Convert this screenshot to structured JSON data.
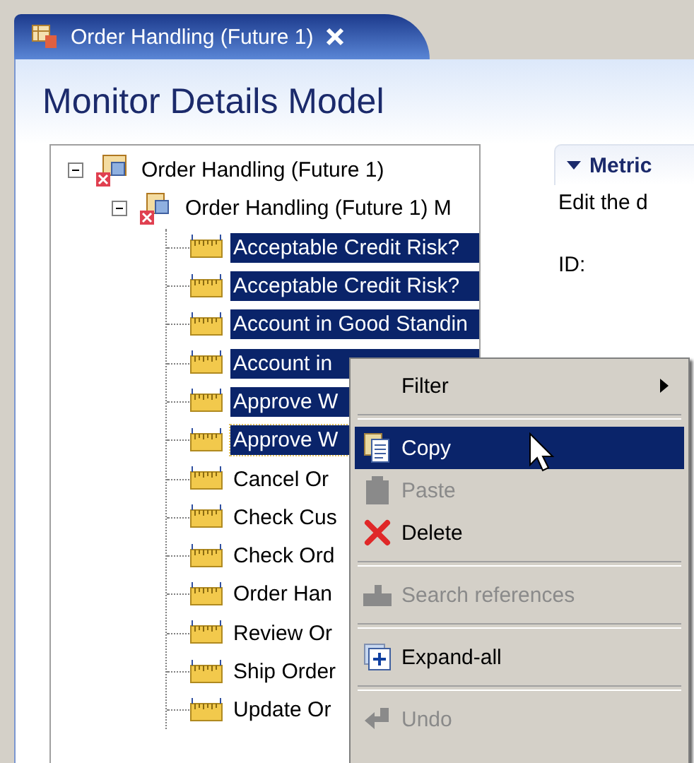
{
  "tab": {
    "title": "Order Handling (Future 1)",
    "selected": true
  },
  "page_title": "Monitor Details Model",
  "tree": [
    {
      "label": "Order Handling (Future 1)",
      "expanded": true,
      "children": [
        {
          "label": "Order Handling (Future 1) M",
          "expanded": true,
          "children": [
            {
              "label": "Acceptable Credit Risk?",
              "selected": true,
              "focused": false
            },
            {
              "label": "Acceptable Credit Risk?",
              "selected": true,
              "focused": false
            },
            {
              "label": "Account in Good Standin",
              "selected": true,
              "focused": false
            },
            {
              "label": "Account in",
              "selected": true,
              "focused": false
            },
            {
              "label": "Approve W",
              "selected": true,
              "focused": false
            },
            {
              "label": "Approve W",
              "selected": true,
              "focused": true
            },
            {
              "label": "Cancel Or",
              "selected": false,
              "focused": false
            },
            {
              "label": "Check Cus",
              "selected": false,
              "focused": false
            },
            {
              "label": "Check Ord",
              "selected": false,
              "focused": false
            },
            {
              "label": "Order Han",
              "selected": false,
              "focused": false
            },
            {
              "label": "Review Or",
              "selected": false,
              "focused": false
            },
            {
              "label": "Ship Order",
              "selected": false,
              "focused": false
            },
            {
              "label": "Update Or",
              "selected": false,
              "focused": false
            }
          ]
        }
      ]
    }
  ],
  "section": {
    "title": "Metric",
    "expanded": true,
    "description": "Edit the d",
    "fields": [
      {
        "label": "ID:"
      }
    ]
  },
  "context_menu": {
    "groups": [
      [
        {
          "label": "Filter",
          "submenu": true,
          "disabled": false,
          "selected": false
        }
      ],
      [
        {
          "label": "Copy",
          "submenu": false,
          "disabled": false,
          "selected": true
        },
        {
          "label": "Paste",
          "submenu": false,
          "disabled": true,
          "selected": false
        },
        {
          "label": "Delete",
          "submenu": false,
          "disabled": false,
          "selected": false
        }
      ],
      [
        {
          "label": "Search references",
          "submenu": false,
          "disabled": true,
          "selected": false
        }
      ],
      [
        {
          "label": "Expand-all",
          "submenu": false,
          "disabled": false,
          "selected": false
        }
      ],
      [
        {
          "label": "Undo",
          "submenu": false,
          "disabled": true,
          "selected": false
        }
      ]
    ]
  }
}
